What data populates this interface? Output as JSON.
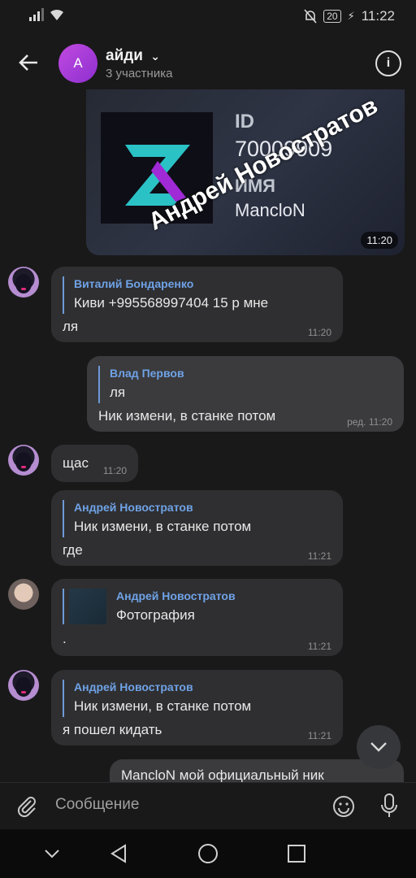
{
  "status_bar": {
    "battery": "20",
    "time": "11:22"
  },
  "header": {
    "avatar_letter": "A",
    "title": "айди",
    "subtitle": "3 участника"
  },
  "image_message": {
    "id_label": "ID",
    "id_value": "70009909",
    "name_label": "ИМЯ",
    "name_value": "MancloN",
    "watermark": "Андрей Новостратов",
    "time": "11:20"
  },
  "messages": [
    {
      "reply_name": "Виталий Бондаренко",
      "reply_text": "Киви +995568997404 15 р мне",
      "text": "ля",
      "time": "11:20"
    },
    {
      "reply_name": "Влад Первов",
      "reply_text": "ля",
      "text": "Ник измени, в станке потом",
      "time": "ред. 11:20"
    },
    {
      "text": "щас",
      "time": "11:20"
    },
    {
      "reply_name": "Андрей Новостратов",
      "reply_text": "Ник измени, в станке потом",
      "text": "где",
      "time": "11:21"
    },
    {
      "reply_name": "Андрей Новостратов",
      "reply_text": "Фотография",
      "text": ".",
      "time": "11:21"
    },
    {
      "reply_name": "Андрей Новостратов",
      "reply_text": "Ник измени, в станке потом",
      "text": "я пошел кидать",
      "time": "11:21"
    },
    {
      "text": "MancloN мой официальный ник"
    }
  ],
  "composer": {
    "placeholder": "Сообщение"
  },
  "colors": {
    "background": "#19191a",
    "bubble_in": "#2f2f31",
    "bubble_out": "#3b3b3d",
    "reply_accent": "#6fa2e6",
    "avatar": "#b947dd"
  },
  "icons": [
    "back-arrow-icon",
    "info-icon",
    "chevron-down-icon",
    "attach-icon",
    "emoji-icon",
    "mic-icon",
    "nav-back-icon",
    "nav-home-icon",
    "nav-recents-icon",
    "nav-hide-icon"
  ]
}
